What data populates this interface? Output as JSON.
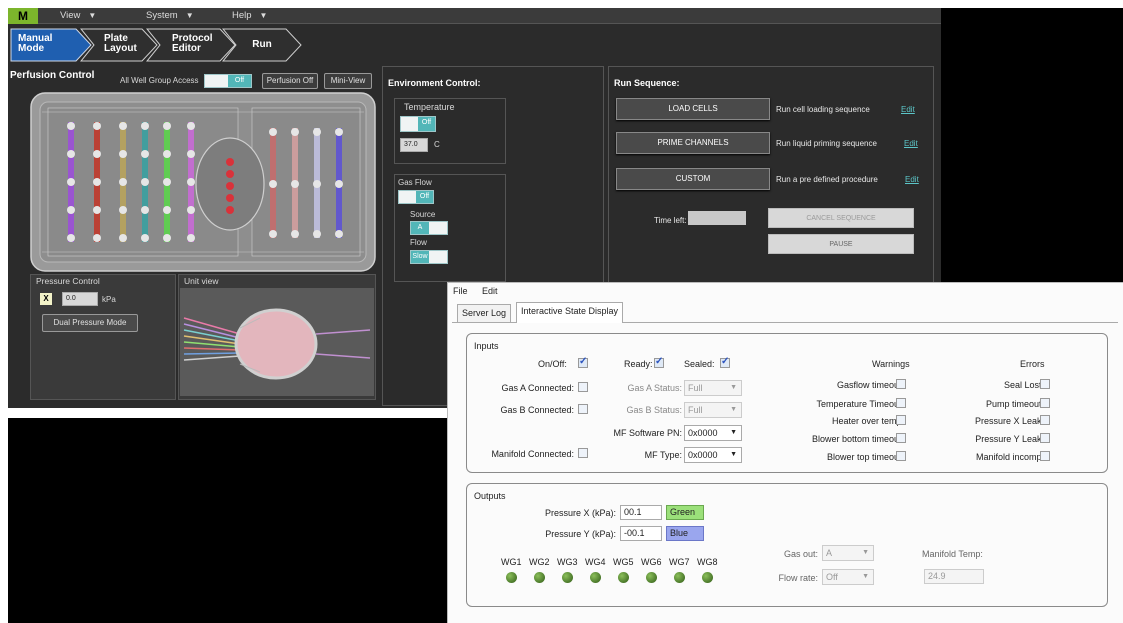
{
  "menubar": {
    "logo": "M",
    "items": [
      "View",
      "System",
      "Help"
    ]
  },
  "breadcrumbs": [
    {
      "line1": "Manual",
      "line2": "Mode"
    },
    {
      "line1": "Plate",
      "line2": "Layout"
    },
    {
      "line1": "Protocol",
      "line2": "Editor"
    },
    {
      "line1": "Run",
      "line2": ""
    }
  ],
  "perfusion": {
    "title": "Perfusion Control",
    "all_well_label": "All Well Group Access",
    "all_well_toggle": "Off",
    "perfusion_off_btn": "Perfusion Off",
    "mini_view_btn": "Mini-View"
  },
  "pressure": {
    "title": "Pressure Control",
    "x_label": "X",
    "value": "0.0",
    "unit": "kPa",
    "dual_btn": "Dual Pressure Mode"
  },
  "unit_view": {
    "title": "Unit view"
  },
  "environment": {
    "title": "Environment Control:",
    "temperature_label": "Temperature",
    "temp_toggle": "Off",
    "temp_value": "37.0",
    "temp_unit": "C",
    "gas_flow_label": "Gas Flow",
    "gas_toggle": "Off",
    "source_label": "Source",
    "source_value": "A",
    "flow_label": "Flow",
    "flow_value": "Slow"
  },
  "run_sequence": {
    "title": "Run Sequence:",
    "rows": [
      {
        "button": "LOAD CELLS",
        "desc": "Run cell loading sequence",
        "edit": "Edit"
      },
      {
        "button": "PRIME CHANNELS",
        "desc": "Run liquid priming sequence",
        "edit": "Edit"
      },
      {
        "button": "CUSTOM",
        "desc": "Run a pre defined procedure",
        "edit": "Edit"
      }
    ],
    "time_left_label": "Time left:",
    "cancel_btn": "CANCEL SEQUENCE",
    "pause_btn": "PAUSE"
  },
  "state_window": {
    "menu": [
      "File",
      "Edit"
    ],
    "tabs": [
      "Server Log",
      "Interactive State Display"
    ],
    "inputs": {
      "title": "Inputs",
      "on_off": "On/Off:",
      "ready": "Ready:",
      "sealed": "Sealed:",
      "gas_a_connected": "Gas A Connected:",
      "gas_b_connected": "Gas B Connected:",
      "manifold_connected": "Manifold Connected:",
      "gas_a_status": "Gas A Status:",
      "gas_a_status_value": "Full",
      "gas_b_status": "Gas B Status:",
      "gas_b_status_value": "Full",
      "mf_software_pn": "MF Software PN:",
      "mf_software_pn_value": "0x0000",
      "mf_type": "MF Type:",
      "mf_type_value": "0x0000",
      "warnings_title": "Warnings",
      "warnings": [
        "Gasflow timeout:",
        "Temperature Timeout:",
        "Heater over temp:",
        "Blower bottom timeout:",
        "Blower top timeout:"
      ],
      "errors_title": "Errors",
      "errors": [
        "Seal Lost:",
        "Pump timeout:",
        "Pressure X Leak:",
        "Pressure Y Leak:",
        "Manifold incomp:"
      ]
    },
    "outputs": {
      "title": "Outputs",
      "pressure_x_label": "Pressure X (kPa):",
      "pressure_x_value": "00.1",
      "pressure_x_color": "Green",
      "pressure_y_label": "Pressure Y (kPa):",
      "pressure_y_value": "-00.1",
      "pressure_y_color": "Blue",
      "wg_labels": [
        "WG1",
        "WG2",
        "WG3",
        "WG4",
        "WG5",
        "WG6",
        "WG7",
        "WG8"
      ],
      "gas_out_label": "Gas out:",
      "gas_out_value": "A",
      "flow_rate_label": "Flow rate:",
      "flow_rate_value": "Off",
      "manifold_temp_label": "Manifold Temp:",
      "manifold_temp_value": "24.9"
    }
  },
  "colors": {
    "accent_teal": "#52b6b8",
    "logo_green": "#7cb52c",
    "dark_bg": "#2b2b2b",
    "green_tag": "#9be07a",
    "blue_tag": "#9aa6ee"
  }
}
